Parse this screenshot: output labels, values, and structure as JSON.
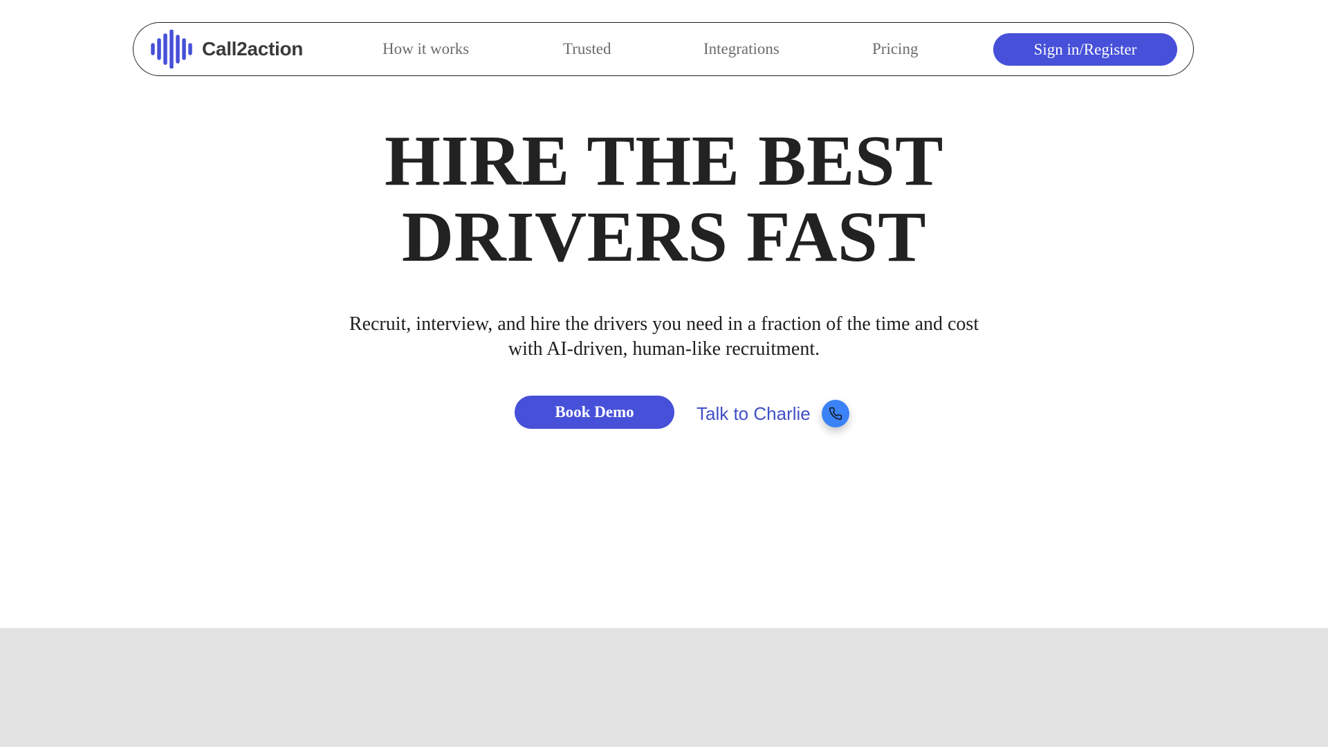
{
  "header": {
    "brand": "Call2action",
    "logo_icon": "sound-wave-icon",
    "nav_links": [
      {
        "label": "How it works"
      },
      {
        "label": "Trusted"
      },
      {
        "label": "Integrations"
      },
      {
        "label": "Pricing"
      }
    ],
    "signin_label": "Sign in/Register"
  },
  "hero": {
    "headline_line1": "HIRE THE BEST",
    "headline_line2": "DRIVERS FAST",
    "subtitle_line1": "Recruit, interview, and hire the drivers you need in a fraction of the time and cost",
    "subtitle_line2": "with AI-driven, human-like recruitment.",
    "book_demo_label": "Book Demo",
    "talk_label": "Talk to Charlie",
    "talk_icon": "phone-icon"
  },
  "colors": {
    "accent": "#4650d8",
    "phone_button": "#3b82f6",
    "talk_text": "#3f4fc4",
    "headline": "#222222",
    "footer_band": "#e3e3e4"
  }
}
